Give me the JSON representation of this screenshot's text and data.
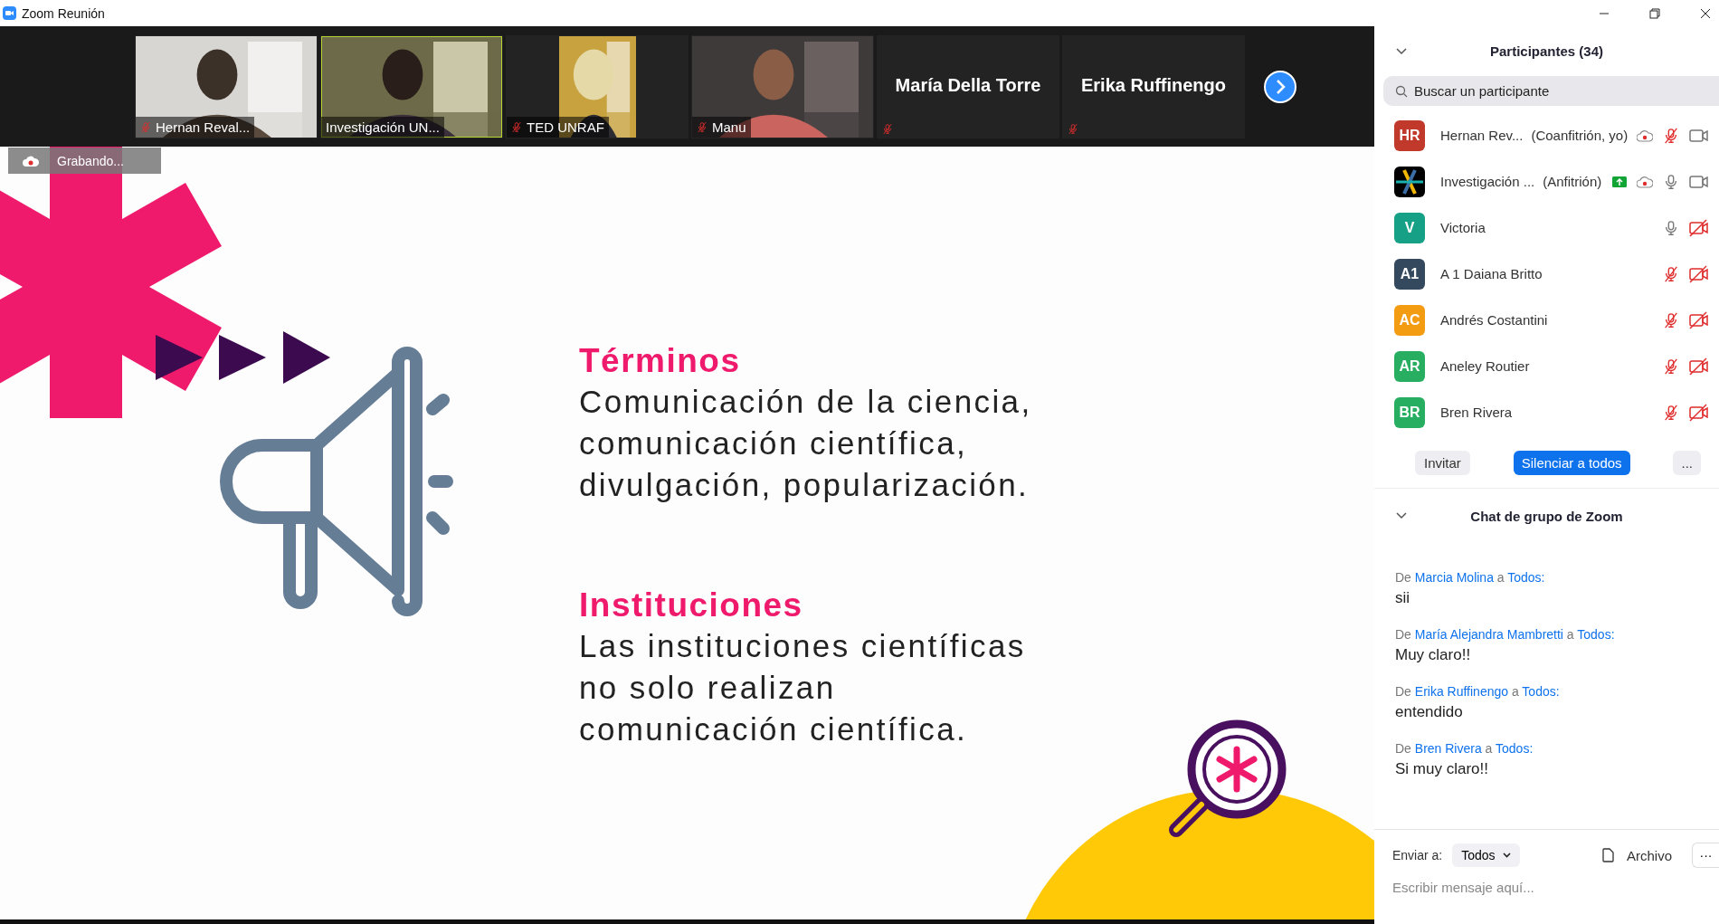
{
  "window": {
    "title": "Zoom Reunión"
  },
  "video_tiles": [
    {
      "kind": "video",
      "name": "Hernan Reval...",
      "muted": true,
      "active": false
    },
    {
      "kind": "video",
      "name": "Investigación UN...",
      "muted": false,
      "active": true
    },
    {
      "kind": "video_narrow",
      "name": "TED UNRAF",
      "muted": true,
      "active": false
    },
    {
      "kind": "video",
      "name": "Manu",
      "muted": true,
      "active": false
    },
    {
      "kind": "name",
      "name": "María Della Torre",
      "muted": true,
      "active": false
    },
    {
      "kind": "name",
      "name": "Erika Ruffinengo",
      "muted": true,
      "active": false
    }
  ],
  "recording": {
    "label": "Grabando..."
  },
  "slide": {
    "sections": [
      {
        "heading": "Términos",
        "lines": [
          "Comunicación de la ciencia,",
          "comunicación científica,",
          "divulgación, popularización."
        ]
      },
      {
        "heading": "Instituciones",
        "lines": [
          "Las instituciones científicas",
          "no solo realizan",
          "comunicación científica."
        ]
      }
    ]
  },
  "participants": {
    "title": "Participantes (34)",
    "search": {
      "placeholder": "Buscar un participante"
    },
    "items": [
      {
        "kind": "initials",
        "initials": "HR",
        "color": "#c0392b",
        "name": "Hernan Rev...",
        "role": "(Coanfitrión, yo)",
        "sharing": false,
        "recording": true,
        "mic_muted": true,
        "video_off": false
      },
      {
        "kind": "logo",
        "name": "Investigación ...",
        "role": "(Anfitrión)",
        "sharing": true,
        "recording": true,
        "mic_muted": false,
        "video_off": false
      },
      {
        "kind": "initials",
        "initials": "V",
        "color": "#16a085",
        "name": "Victoria",
        "sharing": false,
        "recording": false,
        "mic_muted": false,
        "video_off": true
      },
      {
        "kind": "initials",
        "initials": "A1",
        "color": "#34495e",
        "name": "A 1 Daiana Britto",
        "sharing": false,
        "recording": false,
        "mic_muted": true,
        "video_off": true
      },
      {
        "kind": "initials",
        "initials": "AC",
        "color": "#f39c12",
        "name": "Andrés Costantini",
        "sharing": false,
        "recording": false,
        "mic_muted": true,
        "video_off": true
      },
      {
        "kind": "initials",
        "initials": "AR",
        "color": "#27ae60",
        "name": "Aneley Routier",
        "sharing": false,
        "recording": false,
        "mic_muted": true,
        "video_off": true
      },
      {
        "kind": "initials",
        "initials": "BR",
        "color": "#27ae60",
        "name": "Bren Rivera",
        "sharing": false,
        "recording": false,
        "mic_muted": true,
        "video_off": true
      }
    ],
    "buttons": [
      {
        "kind": "plain",
        "label": "Invitar"
      },
      {
        "kind": "primary",
        "label": "Silenciar a todos"
      },
      {
        "kind": "more",
        "label": "..."
      }
    ]
  },
  "chat": {
    "title": "Chat de grupo de Zoom",
    "messages": [
      {
        "from_label": "De",
        "sender": "Marcia Molina",
        "to_label": "a",
        "recipient": "Todos:",
        "text": "sii"
      },
      {
        "from_label": "De",
        "sender": "María Alejandra Mambretti",
        "to_label": "a",
        "recipient": "Todos:",
        "text": "Muy claro!!"
      },
      {
        "from_label": "De",
        "sender": "Erika Ruffinengo",
        "to_label": "a",
        "recipient": "Todos:",
        "text": "entendido"
      },
      {
        "from_label": "De",
        "sender": "Bren Rivera",
        "to_label": "a",
        "recipient": "Todos:",
        "text": "Si muy claro!!"
      }
    ],
    "send_to": {
      "label": "Enviar a:",
      "value": "Todos"
    },
    "file_button": "Archivo",
    "more_button": "···",
    "input": {
      "placeholder": "Escribir mensaje aquí..."
    }
  }
}
